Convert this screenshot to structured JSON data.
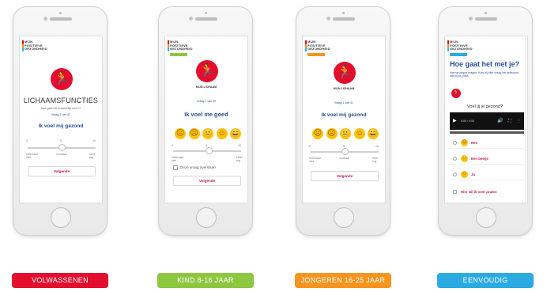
{
  "logo": {
    "lines": [
      "MIJN",
      "POSITIEVE",
      "GEZONDHEID"
    ]
  },
  "phones": [
    {
      "category": "VOLWASSENEN",
      "color": "#e30d2e",
      "title": "LICHAAMSFUNCTIES",
      "subtitle": "Hoe gaat het lichamelijk met u?",
      "question_counter": "Vraag 1 van 42",
      "statement": "Ik voel mij gezond",
      "scale_min": "0",
      "scale_mid": "5",
      "scale_max": "10",
      "label_left": "helemaal niet",
      "label_mid": "neutraal",
      "label_right": "heel erg",
      "button": "Volgende"
    },
    {
      "category": "KIND 8-16 JAAR",
      "color": "#8dc63f",
      "title": "MIJN LICHAAM",
      "question_counter": "Vraag 1 van 39",
      "statement": "Ik voel me goed",
      "scale_min": "0",
      "scale_mid": "5",
      "scale_max": "10",
      "label_left": "Helemaal niet",
      "label_right": "Heel erg",
      "skip_label": "Deze vraag overslaan",
      "button": "Volgende"
    },
    {
      "category": "JONGEREN 16-25 JAAR",
      "color": "#f7941d",
      "title": "MIJN LICHAAM",
      "question_counter": "Vraag 1 van 41",
      "statement": "Ik voel mij gezond",
      "scale_min": "0",
      "scale_mid": "5",
      "scale_max": "10",
      "label_left": "helemaal niet",
      "label_mid": "neutraal",
      "label_right": "heel erg",
      "button": "Volgende"
    },
    {
      "category": "EENVOUDIG",
      "color": "#29abe2",
      "title": "Hoe gaat het met je?",
      "intro": "Hierna volgen vragen. Kies bij elke vraag het antwoord dat bij jou past.",
      "question": "Voel jij je gezond?",
      "video_time": "0:00 / 0:00",
      "options": [
        "Nee",
        "Een beetje",
        "Ja"
      ],
      "talk_option": "Hier wil ik over praten"
    }
  ]
}
